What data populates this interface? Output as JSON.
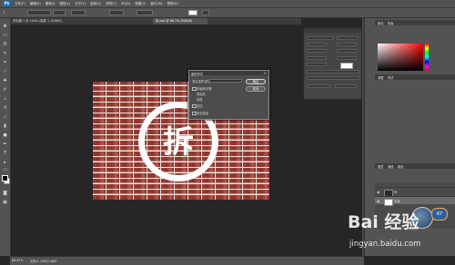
{
  "app": {
    "logo": "Ps",
    "menus": [
      "文件(F)",
      "编辑(E)",
      "图像(I)",
      "图层(L)",
      "文字(Y)",
      "选择(S)",
      "滤镜(T)",
      "3D(D)",
      "视图(V)",
      "窗口(W)",
      "帮助(H)"
    ]
  },
  "tabs": [
    {
      "label": "未标题-1 @ 100% (图层 1, RGB/8)",
      "active": false
    },
    {
      "label": "拆.psd @ 66.7% (RGB/8)",
      "active": true
    }
  ],
  "dialog": {
    "title": "图层样式",
    "rows": [
      "混合选项:默认",
      "斜面和浮雕",
      "等高线",
      "纹理",
      "描边",
      "颜色叠加"
    ],
    "ok_label": "确定",
    "cancel_label": "取消"
  },
  "canvas": {
    "stamp_char": "拆"
  },
  "right_dock": {
    "panel_tabs_top": [
      "颜色",
      "色板"
    ],
    "panel_tabs_mid": [
      "调整",
      "样式"
    ],
    "panel_tabs_layers": [
      "图层",
      "通道",
      "路径"
    ],
    "layers": [
      {
        "name": "拆",
        "selected": false
      },
      {
        "name": "背景",
        "selected": true
      }
    ]
  },
  "status": {
    "zoom": "66.67%",
    "doc": "文档:1.23M/2.46M"
  },
  "watermark": {
    "logo": "Bai 经验",
    "url": "jingyan.baidu.com",
    "badge": "67"
  },
  "colors": {
    "ui_bg": "#262626",
    "panel": "#535353",
    "brick": "#9a3f38",
    "stamp": "#ffffff"
  }
}
